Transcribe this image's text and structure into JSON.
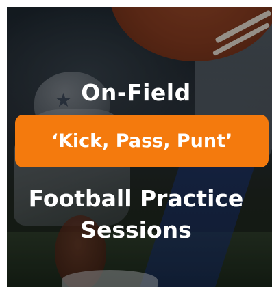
{
  "promo": {
    "title_top": "On-Field",
    "banner_label": "‘Kick, Pass, Punt’",
    "title_bottom_line1": "Football Practice",
    "title_bottom_line2": "Sessions"
  },
  "colors": {
    "banner": "#f47a0d",
    "text": "#ffffff"
  }
}
